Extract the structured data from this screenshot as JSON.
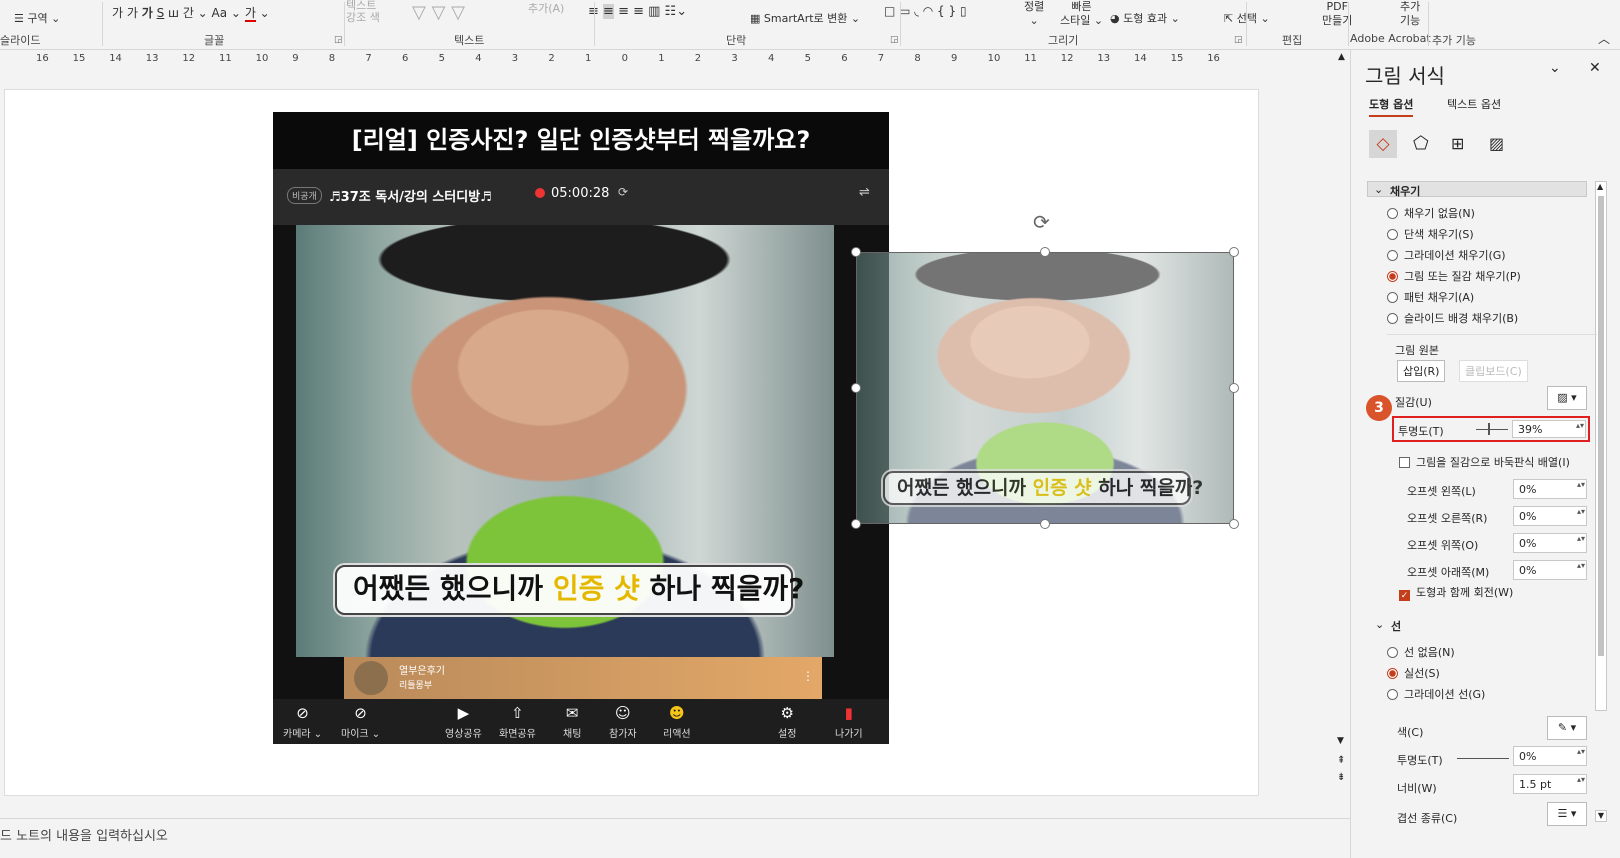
{
  "ribbon": {
    "groups": [
      {
        "label": "슬라이드"
      },
      {
        "label": "글꼴"
      },
      {
        "label": "텍스트"
      },
      {
        "label": "단락"
      },
      {
        "label": "그리기"
      },
      {
        "label": "편집"
      },
      {
        "label": "Adobe Acrobat"
      },
      {
        "label": "추가 기능"
      }
    ],
    "section_btn": "구역",
    "smartart_btn": "SmartArt로 변환",
    "text_effect": "텍스트\n강조 색",
    "add_text": "추가(A)",
    "arrange": "정렬",
    "quick_style": "빠른\n스타일",
    "shape_effect": "도형 효과",
    "select": "선택",
    "pdf": "PDF\n만들기",
    "addin": "추가\n기능"
  },
  "ruler": {
    "ticks": [
      "16",
      "15",
      "14",
      "13",
      "12",
      "11",
      "10",
      "9",
      "8",
      "7",
      "6",
      "5",
      "4",
      "3",
      "2",
      "1",
      "0",
      "1",
      "2",
      "3",
      "4",
      "5",
      "6",
      "7",
      "8",
      "9",
      "10",
      "11",
      "12",
      "13",
      "14",
      "15",
      "16"
    ]
  },
  "slide": {
    "title": "[리얼] 인증사진? 일단 인증샷부터 찍을까요?",
    "badge": "비공개",
    "room": "♬37조 독서/강의 스터디방♬",
    "timer": "05:00:28",
    "subtitle_pre": "어쨌든 했으니까 ",
    "subtitle_hl": "인증 샷",
    "subtitle_post": " 하나 찍을까?",
    "streamer_name": "열부은후기",
    "streamer_sub": "리틀몽부",
    "toolbar": [
      "카메라 ⌄",
      "마이크 ⌄",
      "영상공유",
      "화면공유",
      "채팅",
      "참가자",
      "리액션",
      "설정",
      "나가기"
    ]
  },
  "notes": {
    "placeholder": "드 노트의 내용을 입력하십시오"
  },
  "pane": {
    "title": "그림 서식",
    "tab_shape": "도형 옵션",
    "tab_text": "텍스트 옵션",
    "fill_section": "채우기",
    "fill_options": [
      {
        "label": "채우기 없음(N)",
        "on": false
      },
      {
        "label": "단색 채우기(S)",
        "on": false
      },
      {
        "label": "그라데이션 채우기(G)",
        "on": false
      },
      {
        "label": "그림 또는 질감 채우기(P)",
        "on": true
      },
      {
        "label": "패턴 채우기(A)",
        "on": false
      },
      {
        "label": "슬라이드 배경 채우기(B)",
        "on": false
      }
    ],
    "source_label": "그림 원본",
    "insert_btn": "삽입(R)",
    "clipboard_btn": "클립보드(C)",
    "texture_label": "질감(U)",
    "transparency_label": "투명도(T)",
    "transparency_value": "39%",
    "step_badge": "3",
    "tile_label": "그림을 질감으로 바둑판식 배열(I)",
    "offsets": [
      {
        "label": "오프셋 왼쪽(L)",
        "value": "0%"
      },
      {
        "label": "오프셋 오른쪽(R)",
        "value": "0%"
      },
      {
        "label": "오프셋 위쪽(O)",
        "value": "0%"
      },
      {
        "label": "오프셋 아래쪽(M)",
        "value": "0%"
      }
    ],
    "rotate_label": "도형과 함께 회전(W)",
    "line_section": "선",
    "line_options": [
      {
        "label": "선 없음(N)",
        "on": false
      },
      {
        "label": "실선(S)",
        "on": true
      },
      {
        "label": "그라데이션 선(G)",
        "on": false
      }
    ],
    "color_label": "색(C)",
    "line_transparency_label": "투명도(T)",
    "line_transparency_value": "0%",
    "width_label": "너비(W)",
    "width_value": "1.5 pt",
    "compound_label": "겹선 종류(C)"
  }
}
